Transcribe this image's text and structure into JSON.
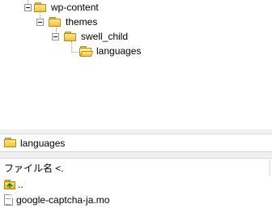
{
  "tree": {
    "items": [
      {
        "label": "wp-content",
        "level": 0,
        "expanded": true,
        "icon": "folder-icon"
      },
      {
        "label": "themes",
        "level": 1,
        "expanded": true,
        "icon": "folder-icon"
      },
      {
        "label": "swell_child",
        "level": 2,
        "expanded": true,
        "icon": "folder-icon"
      },
      {
        "label": "languages",
        "level": 3,
        "expanded": false,
        "icon": "folder-open-icon"
      }
    ]
  },
  "path_bar": {
    "label": "languages",
    "icon": "folder-icon"
  },
  "file_list": {
    "header_name": "ファイル名 <.",
    "rows": [
      {
        "name": "..",
        "icon": "parent-folder-icon"
      },
      {
        "name": "google-captcha-ja.mo",
        "icon": "file-icon"
      }
    ]
  },
  "colors": {
    "folder_fill": "#f0c445",
    "folder_border": "#b78d12",
    "tree_lines": "#a0a0a0",
    "pane_border": "#d6d6d6"
  }
}
